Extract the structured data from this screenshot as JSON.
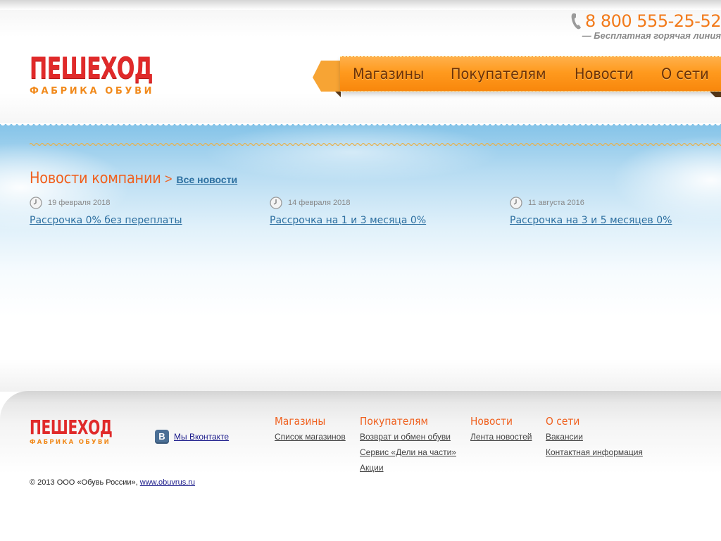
{
  "header": {
    "phone": "8 800 555-25-52",
    "hotline": "— Бесплатная горячая линия",
    "logo_main": "ПЕШЕХОД",
    "logo_sub": "ФАБРИКА ОБУВИ"
  },
  "nav": {
    "items": [
      {
        "label": "Магазины"
      },
      {
        "label": "Покупателям"
      },
      {
        "label": "Новости"
      },
      {
        "label": "О сети"
      }
    ]
  },
  "news": {
    "title": "Новости компании",
    "arrow": ">",
    "all_label": "Все новости",
    "items": [
      {
        "date": "19 февраля 2018",
        "title": "Рассрочка 0% без переплаты"
      },
      {
        "date": "14 февраля 2018",
        "title": "Рассрочка на 1 и 3 месяца 0%"
      },
      {
        "date": "11 августа 2016",
        "title": "Рассрочка на 3 и 5 месяцев 0%"
      }
    ]
  },
  "footer": {
    "logo_main": "ПЕШЕХОД",
    "logo_sub": "ФАБРИКА ОБУВИ",
    "vk_icon_letter": "В",
    "vk_label": "Мы Вконтакте",
    "columns": [
      {
        "title": "Магазины",
        "links": [
          "Список магазинов"
        ]
      },
      {
        "title": "Покупателям",
        "links": [
          "Возврат и обмен обуви",
          "Сервис «Дели на части»",
          "Акции"
        ]
      },
      {
        "title": "Новости",
        "links": [
          "Лента новостей"
        ]
      },
      {
        "title": "О сети",
        "links": [
          "Вакансии",
          "Контактная информация"
        ]
      }
    ],
    "copyright_text": "© 2013 ООО «Обувь России»,",
    "copyright_link": "www.obuvrus.ru"
  },
  "colors": {
    "accent_orange": "#f0601e",
    "logo_red": "#e02a2a",
    "nav_orange": "#ff9a1e",
    "link_blue": "#2c6fa0"
  },
  "icons": [
    "phone-icon",
    "clock-icon",
    "vk-icon"
  ]
}
